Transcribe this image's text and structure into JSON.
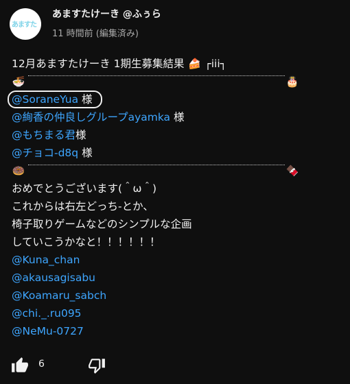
{
  "post": {
    "avatar_text": "あますた",
    "author": "あますたけーき @ふぅら",
    "timestamp": "11 時間前 (編集済み)"
  },
  "content": {
    "title": "12月あますたけーき 1期生募集結果",
    "title_emoji": "🍰",
    "title_suffix": "┌iii┐",
    "divider1_left": "🍜",
    "divider1_right": "🎂",
    "mentions_winners": [
      {
        "handle": "@SoraneYua",
        "suffix": " 様"
      },
      {
        "handle": "@絢香の仲良しグループayamka",
        "suffix": " 様"
      },
      {
        "handle": "@もちまる君",
        "suffix": "様"
      },
      {
        "handle": "@チョコ-d8q",
        "suffix": " 様"
      }
    ],
    "divider2_left": "🍩",
    "divider2_right": "🍫",
    "message_lines": [
      "おめでとうございます(＾ω＾)",
      "これからは右左どっち-とか、",
      "椅子取りゲームなどのシンプルな企画",
      "していこうかなと！！！！！！"
    ],
    "mentions_others": [
      "@Kuna_chan",
      "@akausagisabu",
      "@Koamaru_sabch",
      "@chi._.ru095",
      "@NeMu-0727"
    ]
  },
  "actions": {
    "like_count": "6",
    "like_icon": "thumbs-up-icon",
    "dislike_icon": "thumbs-down-icon"
  }
}
